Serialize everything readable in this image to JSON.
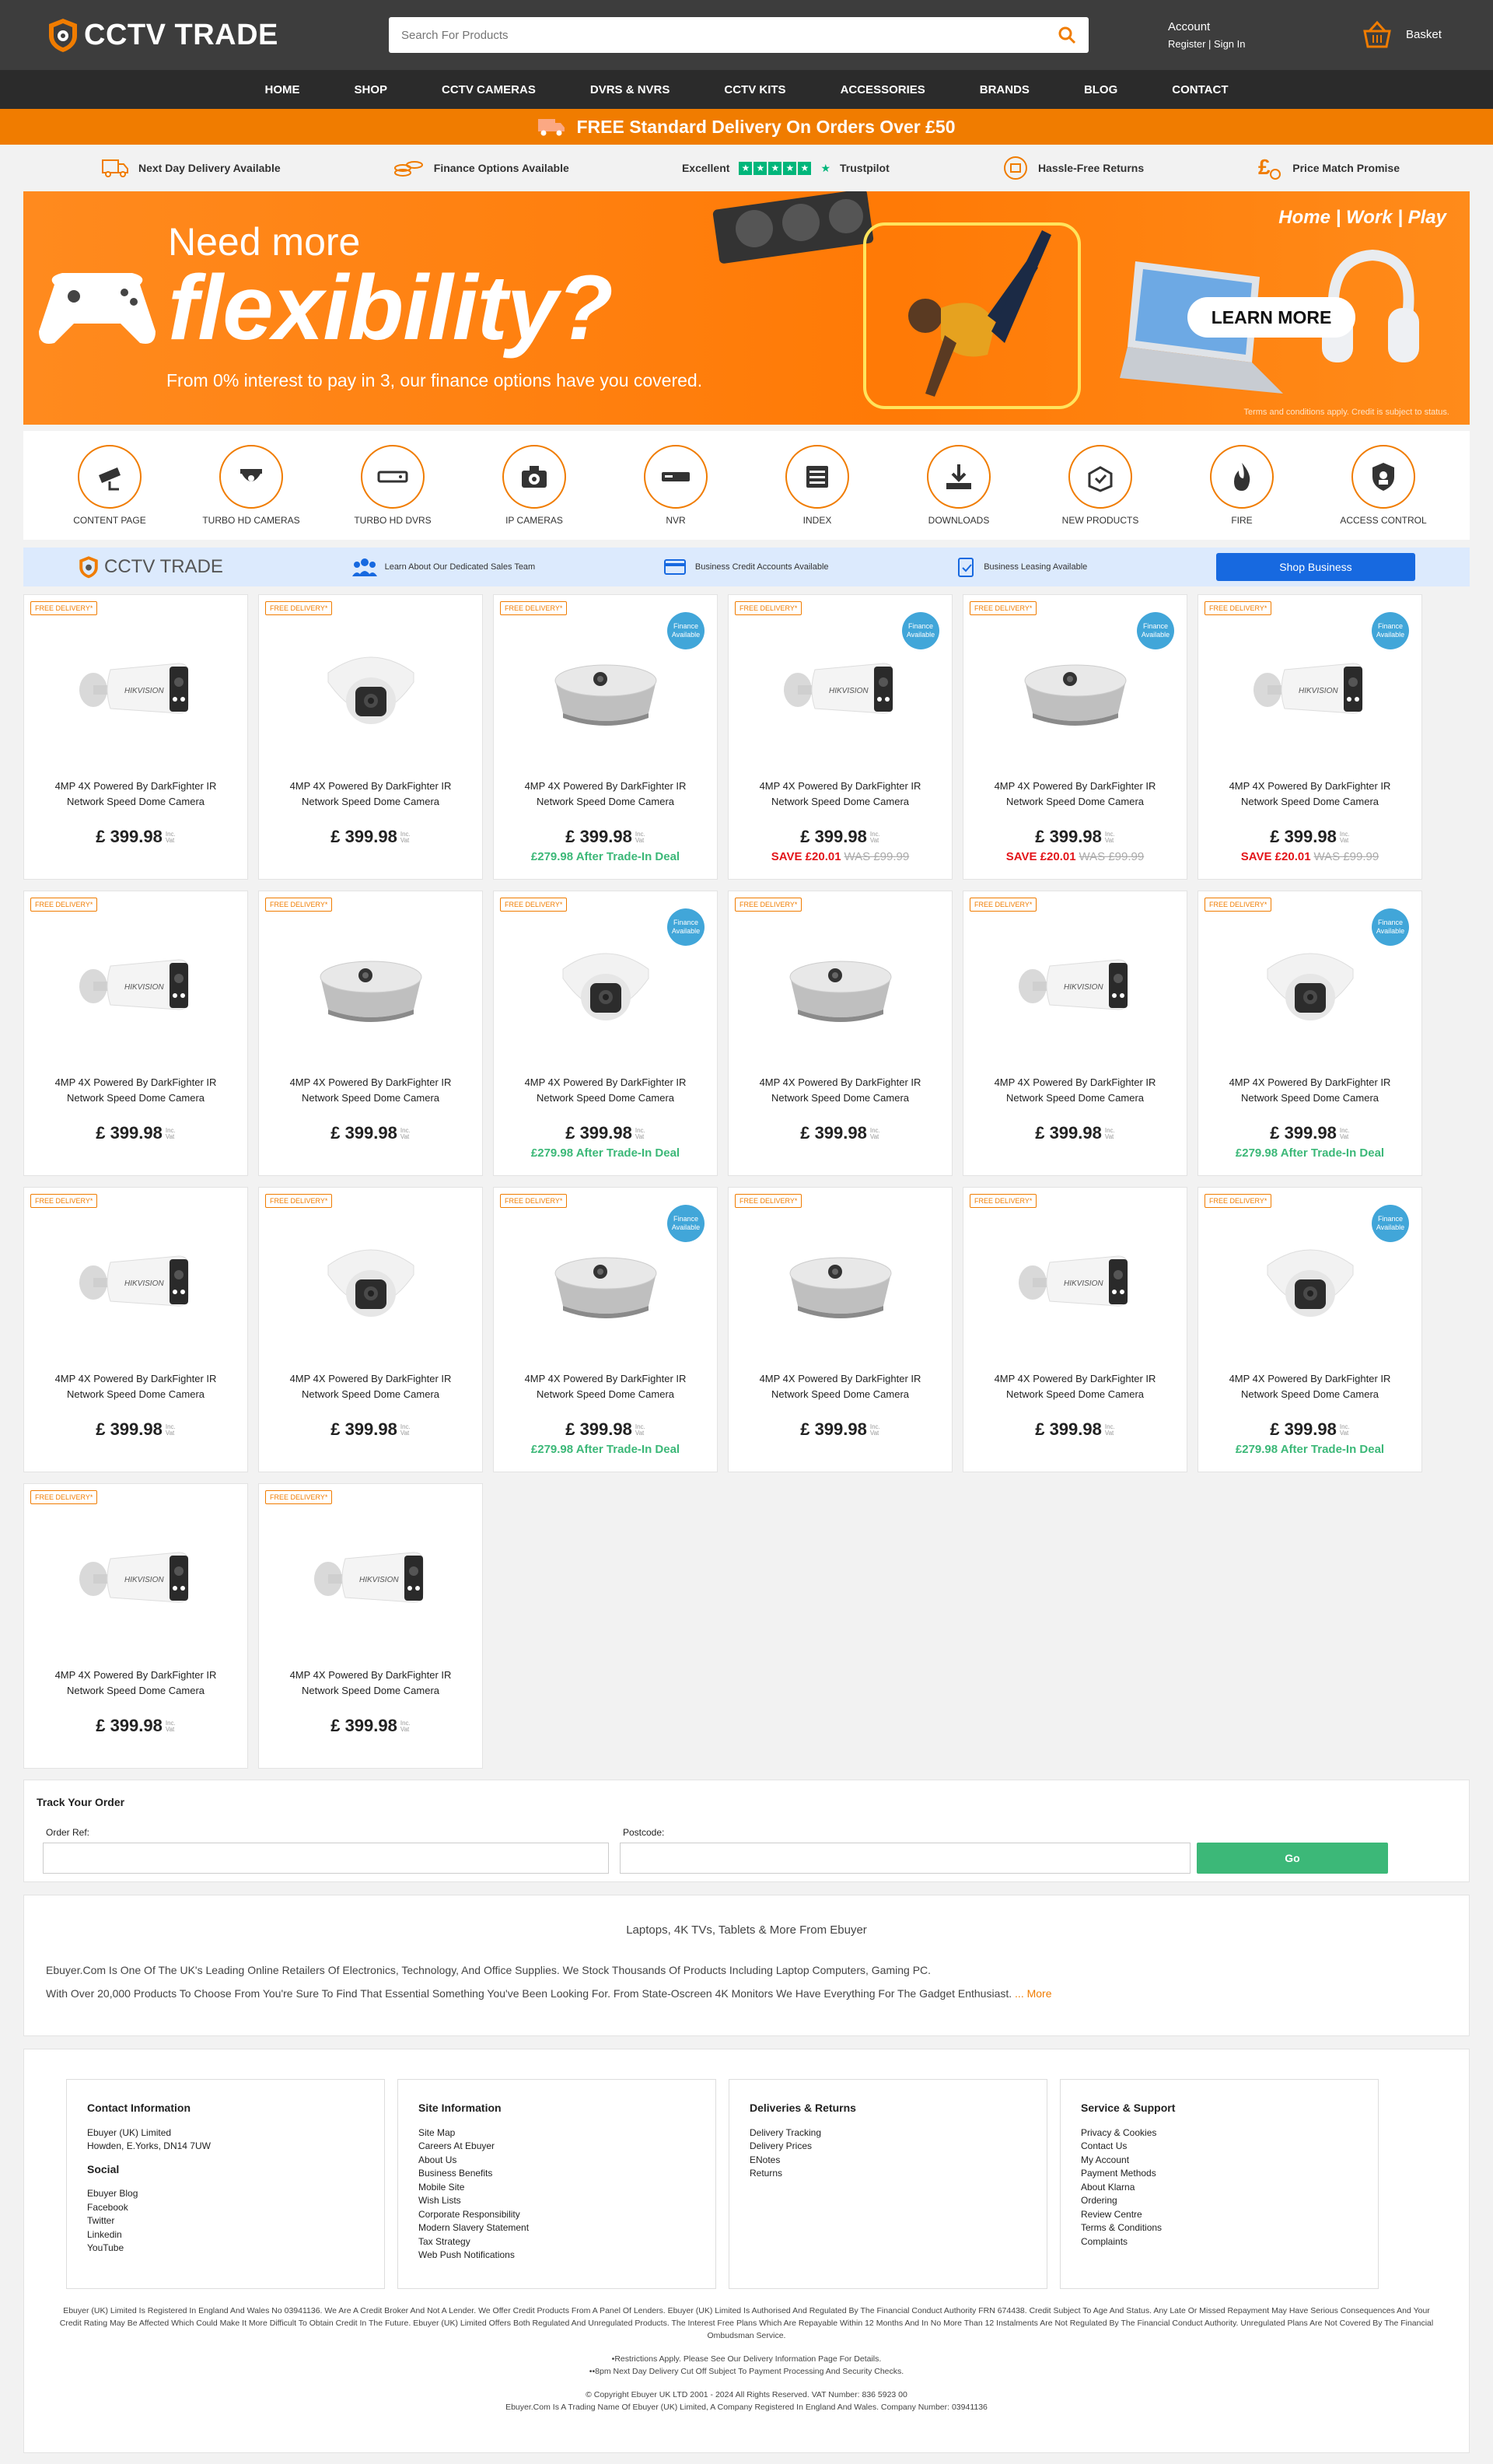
{
  "header": {
    "logo": "CCTV TRADE",
    "search_placeholder": "Search For Products",
    "account_title": "Account",
    "account_links": "Register | Sign In",
    "basket": "Basket"
  },
  "nav": [
    "HOME",
    "SHOP",
    "CCTV CAMERAS",
    "DVRS & NVRS",
    "CCTV KITS",
    "ACCESSORIES",
    "BRANDS",
    "BLOG",
    "CONTACT"
  ],
  "promo": "FREE Standard Delivery On Orders Over £50",
  "usps": {
    "next_day": "Next Day Delivery Available",
    "finance": "Finance Options Available",
    "trust_excellent": "Excellent",
    "trustpilot": "Trustpilot",
    "returns": "Hassle-Free Returns",
    "price_match": "Price Match Promise"
  },
  "banner": {
    "line1": "Need more",
    "line2": "flexibility?",
    "sub": "From 0% interest to pay in 3, our finance options have you covered.",
    "tagline": "Home | Work | Play",
    "cta": "LEARN MORE",
    "terms": "Terms and conditions apply. Credit is subject to status."
  },
  "categories": [
    {
      "label": "CONTENT PAGE",
      "icon": "cctv-camera-icon"
    },
    {
      "label": "TURBO HD CAMERAS",
      "icon": "dome-camera-icon"
    },
    {
      "label": "TURBO HD DVRS",
      "icon": "dvr-icon"
    },
    {
      "label": "IP CAMERAS",
      "icon": "ip-camera-icon"
    },
    {
      "label": "NVR",
      "icon": "nvr-icon"
    },
    {
      "label": "INDEX",
      "icon": "index-icon"
    },
    {
      "label": "DOWNLOADS",
      "icon": "download-icon"
    },
    {
      "label": "NEW PRODUCTS",
      "icon": "new-products-icon"
    },
    {
      "label": "FIRE",
      "icon": "fire-icon"
    },
    {
      "label": "ACCESS CONTROL",
      "icon": "access-control-icon"
    }
  ],
  "business": {
    "logo": "CCTV TRADE",
    "sales": "Learn About Our Dedicated Sales Team",
    "credit": "Business Credit Accounts Available",
    "leasing": "Business Leasing Available",
    "button": "Shop Business"
  },
  "product_common": {
    "free_delivery": "FREE DELIVERY*",
    "finance_badge_1": "Finance",
    "finance_badge_2": "Available",
    "name_1": "4MP 4X Powered By DarkFighter IR",
    "name_2": "Network Speed Dome Camera",
    "price": "£ 399.98",
    "vat_1": "Inc.",
    "vat_2": "Vat"
  },
  "products": [
    {
      "type": "bullet",
      "finance": false,
      "extra": ""
    },
    {
      "type": "turret",
      "finance": false,
      "extra": ""
    },
    {
      "type": "fisheye",
      "finance": true,
      "extra": "£279.98 After Trade-In Deal",
      "extra_type": "green"
    },
    {
      "type": "bullet",
      "finance": true,
      "extra": "SAVE £20.01",
      "was": "WAS £99.99",
      "extra_type": "red"
    },
    {
      "type": "fisheye",
      "finance": true,
      "extra": "SAVE £20.01",
      "was": "WAS £99.99",
      "extra_type": "red"
    },
    {
      "type": "bullet",
      "finance": true,
      "extra": "SAVE £20.01",
      "was": "WAS £99.99",
      "extra_type": "red"
    },
    {
      "type": "bullet",
      "finance": false,
      "extra": ""
    },
    {
      "type": "fisheye",
      "finance": false,
      "extra": ""
    },
    {
      "type": "turret",
      "finance": true,
      "extra": "£279.98 After Trade-In Deal",
      "extra_type": "green"
    },
    {
      "type": "fisheye",
      "finance": false,
      "extra": ""
    },
    {
      "type": "bullet",
      "finance": false,
      "extra": ""
    },
    {
      "type": "turret",
      "finance": true,
      "extra": "£279.98 After Trade-In Deal",
      "extra_type": "green"
    },
    {
      "type": "bullet",
      "finance": false,
      "extra": ""
    },
    {
      "type": "turret",
      "finance": false,
      "extra": ""
    },
    {
      "type": "fisheye",
      "finance": true,
      "extra": "£279.98 After Trade-In Deal",
      "extra_type": "green"
    },
    {
      "type": "fisheye",
      "finance": false,
      "extra": ""
    },
    {
      "type": "bullet",
      "finance": false,
      "extra": ""
    },
    {
      "type": "turret",
      "finance": true,
      "extra": "£279.98 After Trade-In Deal",
      "extra_type": "green"
    },
    {
      "type": "bullet",
      "finance": false,
      "extra": ""
    },
    {
      "type": "bullet",
      "finance": false,
      "extra": ""
    }
  ],
  "track": {
    "title": "Track Your Order",
    "order_ref": "Order Ref:",
    "postcode": "Postcode:",
    "go": "Go"
  },
  "about": {
    "title": "Laptops, 4K TVs, Tablets & More From Ebuyer",
    "p1": "Ebuyer.Com Is One Of The UK's Leading Online Retailers Of Electronics, Technology, And Office Supplies. We Stock Thousands Of Products Including Laptop Computers, Gaming PC.",
    "p2": "With Over 20,000 Products To Choose From You're Sure To Find That Essential Something You've Been Looking For. From State-Oscreen 4K Monitors We Have Everything For The Gadget Enthusiast.",
    "more": "... More"
  },
  "footer": {
    "contact_title": "Contact Information",
    "contact_1": "Ebuyer (UK) Limited",
    "contact_2": "Howden, E.Yorks, DN14 7UW",
    "social_title": "Social",
    "social": [
      "Ebuyer Blog",
      "Facebook",
      "Twitter",
      "Linkedin",
      "YouTube"
    ],
    "site_title": "Site Information",
    "site": [
      "Site Map",
      "Careers At Ebuyer",
      "About Us",
      "Business Benefits",
      "Mobile Site",
      "Wish Lists",
      "Corporate Responsibility",
      "Modern Slavery Statement",
      "Tax Strategy",
      "Web Push Notifications"
    ],
    "deliveries_title": "Deliveries & Returns",
    "deliveries": [
      "Delivery Tracking",
      "Delivery Prices",
      "ENotes",
      "Returns"
    ],
    "service_title": "Service & Support",
    "service": [
      "Privacy & Cookies",
      "Contact Us",
      "My Account",
      "Payment Methods",
      "About Klarna",
      "Ordering",
      "Review Centre",
      "Terms & Conditions",
      "Complaints"
    ],
    "legal_1": "Ebuyer (UK) Limited Is Registered In England And Wales No 03941136. We Are A Credit Broker And Not A Lender. We Offer Credit Products From A Panel Of Lenders. Ebuyer (UK) Limited Is Authorised And Regulated By The Financial Conduct Authority FRN 674438. Credit Subject To Age And Status. Any Late Or Missed Repayment May Have Serious Consequences And Your Credit Rating May Be Affected Which Could Make It More Difficult To Obtain Credit In The Future. Ebuyer (UK) Limited Offers Both Regulated And Unregulated Products. The Interest Free Plans Which Are Repayable Within 12 Months And In No More Than 12 Instalments Are Not Regulated By The Financial Conduct Authority. Unregulated Plans Are Not Covered By The Financial Ombudsman Service.",
    "legal_2": "•Restrictions Apply. Please See Our Delivery Information Page For Details.",
    "legal_3": "••8pm Next Day Delivery Cut Off Subject To Payment Processing And Security Checks.",
    "legal_4": "© Copyright Ebuyer UK LTD 2001 - 2024 All Rights Reserved. VAT Number: 836 5923 00",
    "legal_5": "Ebuyer.Com Is A Trading Name Of Ebuyer (UK) Limited, A Company Registered In England And Wales. Company Number: 03941136"
  }
}
